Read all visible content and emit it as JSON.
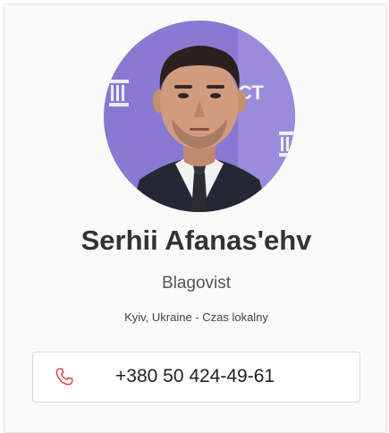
{
  "profile": {
    "name": "Serhii Afanas'ehv",
    "company": "Blagovist",
    "location": "Kyiv, Ukraine - Czas lokalny",
    "phone": "+380 50 424-49-61",
    "avatar": {
      "icon": "profile-photo",
      "backdrop_color": "#8c7bd4"
    },
    "phone_icon": "phone-icon",
    "phone_icon_color": "#d93a3a"
  }
}
